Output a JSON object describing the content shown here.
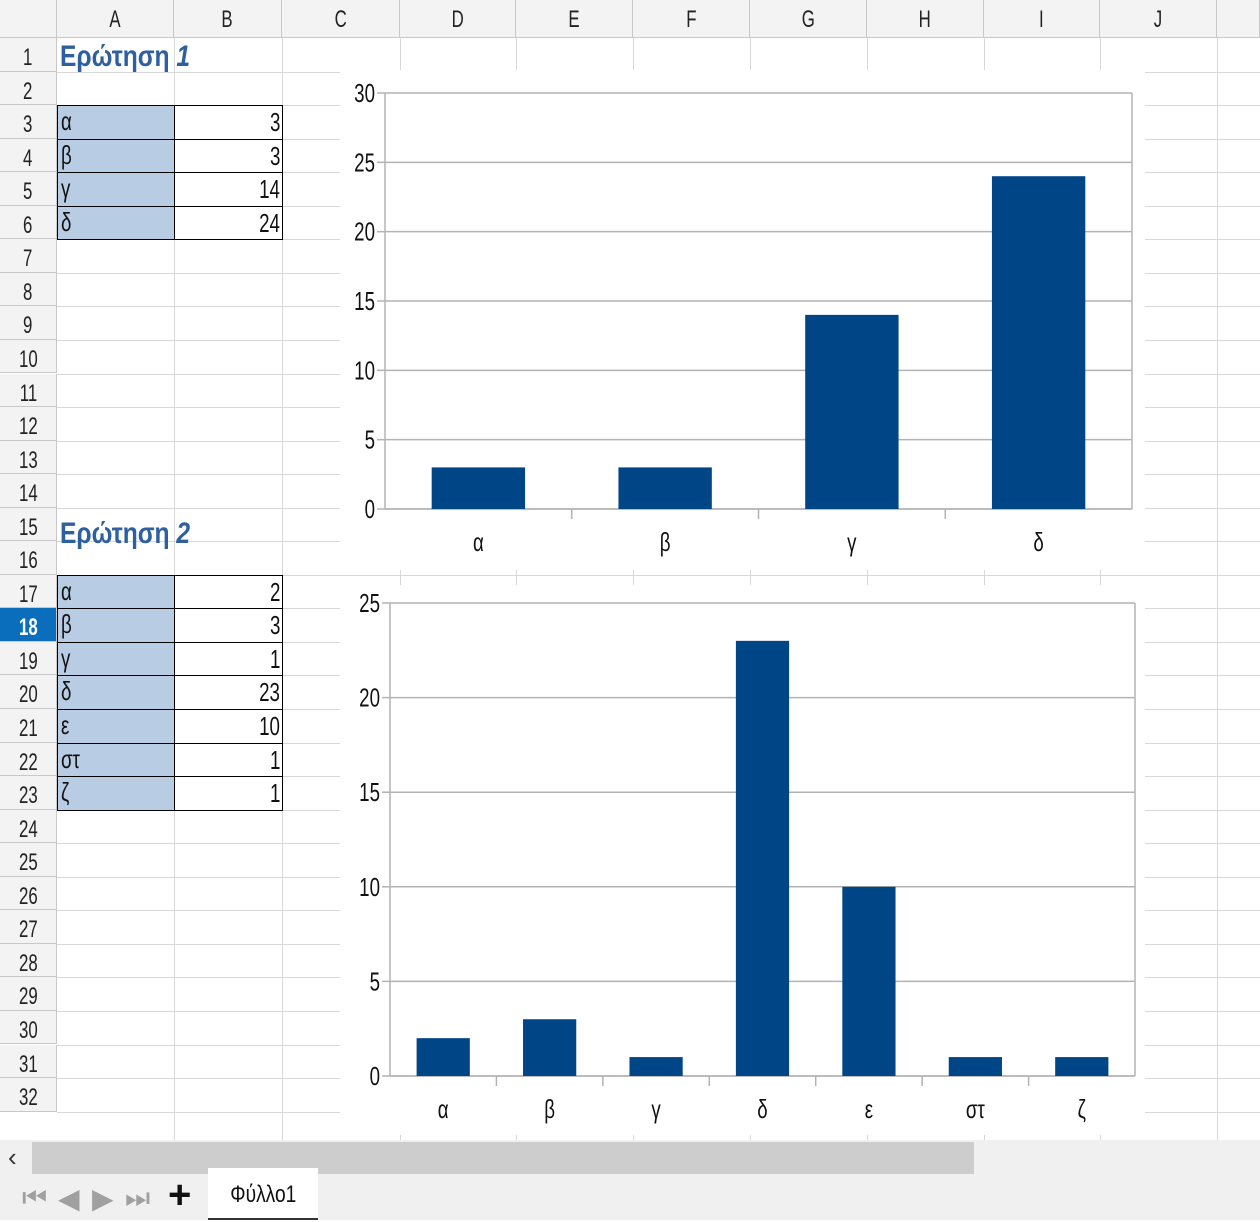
{
  "columns": [
    "A",
    "B",
    "C",
    "D",
    "E",
    "F",
    "G",
    "H",
    "I",
    "J"
  ],
  "rows": [
    "1",
    "2",
    "3",
    "4",
    "5",
    "6",
    "7",
    "8",
    "9",
    "10",
    "11",
    "12",
    "13",
    "14",
    "15",
    "16",
    "17",
    "18",
    "19",
    "20",
    "21",
    "22",
    "23",
    "24",
    "25",
    "26",
    "27",
    "28",
    "29",
    "30",
    "31",
    "32"
  ],
  "active_row": "18",
  "question1": {
    "title_word": "Ερώτηση",
    "title_num": "1",
    "table": [
      {
        "label": "α",
        "value": "3"
      },
      {
        "label": "β",
        "value": "3"
      },
      {
        "label": "γ",
        "value": "14"
      },
      {
        "label": "δ",
        "value": "24"
      }
    ]
  },
  "question2": {
    "title_word": "Ερώτηση",
    "title_num": "2",
    "table": [
      {
        "label": "α",
        "value": "2"
      },
      {
        "label": "β",
        "value": "3"
      },
      {
        "label": "γ",
        "value": "1"
      },
      {
        "label": "δ",
        "value": "23"
      },
      {
        "label": "ε",
        "value": "10"
      },
      {
        "label": "στ",
        "value": "1"
      },
      {
        "label": "ζ",
        "value": "1"
      }
    ]
  },
  "chart_data": [
    {
      "type": "bar",
      "categories": [
        "α",
        "β",
        "γ",
        "δ"
      ],
      "values": [
        3,
        3,
        14,
        24
      ],
      "ylim": [
        0,
        30
      ],
      "yticks": [
        0,
        5,
        10,
        15,
        20,
        25,
        30
      ],
      "grid": true,
      "bar_color": "#004586"
    },
    {
      "type": "bar",
      "categories": [
        "α",
        "β",
        "γ",
        "δ",
        "ε",
        "στ",
        "ζ"
      ],
      "values": [
        2,
        3,
        1,
        23,
        10,
        1,
        1
      ],
      "ylim": [
        0,
        25
      ],
      "yticks": [
        0,
        5,
        10,
        15,
        20,
        25
      ],
      "grid": true,
      "bar_color": "#004586"
    }
  ],
  "bottom_bar": {
    "scroll_left": "‹",
    "nav_first": "⏮",
    "nav_prev": "◀",
    "nav_next": "▶",
    "nav_last": "⏭",
    "add_sheet": "+",
    "sheet_tab": "Φύλλο1"
  }
}
